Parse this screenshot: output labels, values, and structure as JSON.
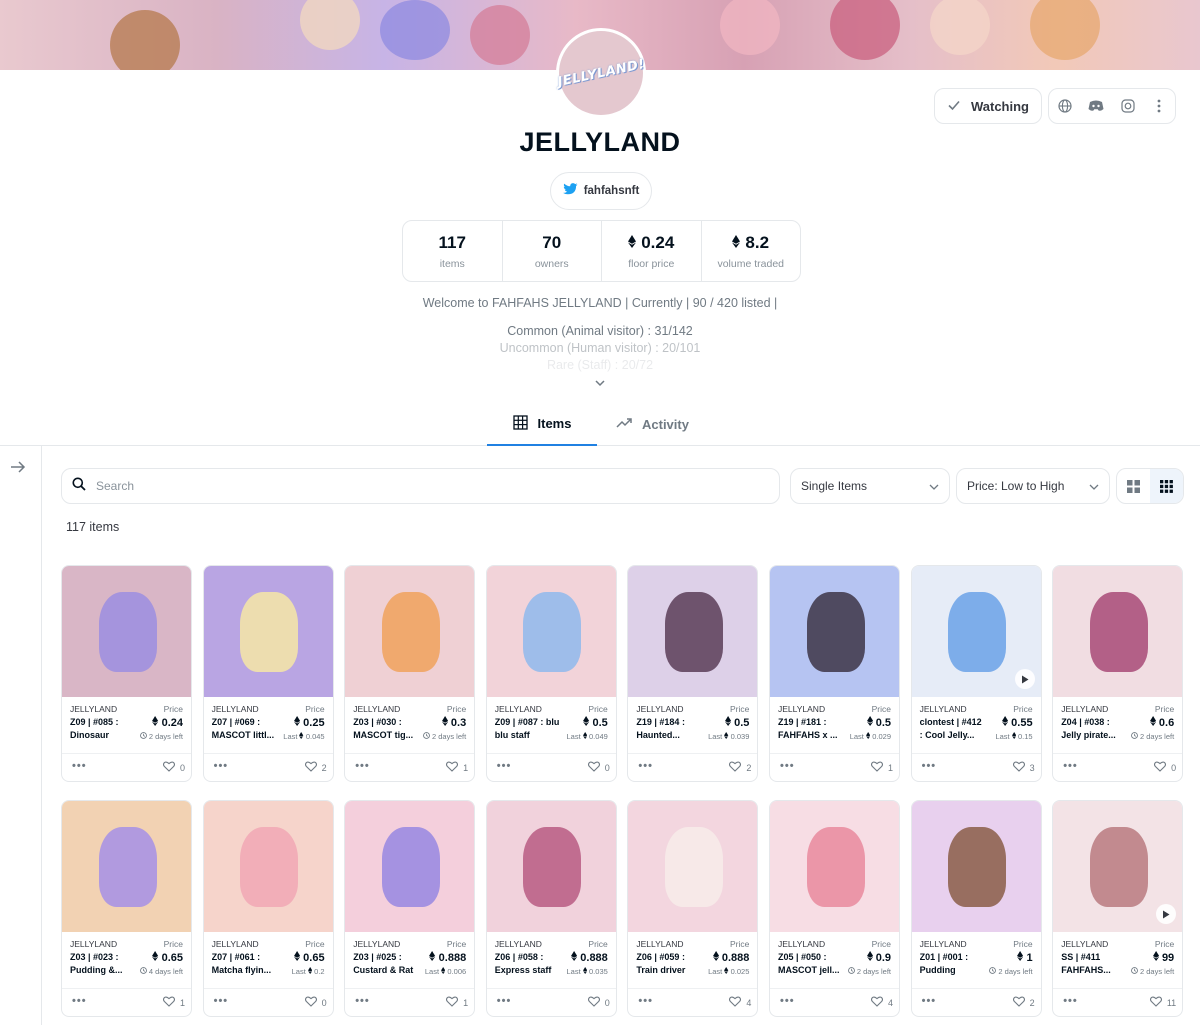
{
  "collection": {
    "name": "JELLYLAND",
    "logo_text": "JELLYLAND!",
    "twitter_handle": "fahfahsnft"
  },
  "actions": {
    "watch_label": "Watching",
    "icons": [
      "globe-icon",
      "discord-icon",
      "instagram-icon",
      "more-vertical-icon"
    ]
  },
  "stats": [
    {
      "value": "117",
      "label": "items",
      "eth": false
    },
    {
      "value": "70",
      "label": "owners",
      "eth": false
    },
    {
      "value": "0.24",
      "label": "floor price",
      "eth": true
    },
    {
      "value": "8.2",
      "label": "volume traded",
      "eth": true
    }
  ],
  "description": {
    "line1": "Welcome to FAHFAHS JELLYLAND | Currently | 90 / 420 listed |",
    "line2": "Common (Animal visitor) : 31/142",
    "line3": "Uncommon (Human visitor) : 20/101",
    "line4": "Rare (Staff) : 20/72"
  },
  "tabs": [
    {
      "label": "Items",
      "active": true
    },
    {
      "label": "Activity",
      "active": false
    }
  ],
  "filters": {
    "search_placeholder": "Search",
    "item_type": "Single Items",
    "sort": "Price: Low to High",
    "item_count": "117 items"
  },
  "colors": {
    "accent": "#2081e2",
    "border": "#e5e8eb",
    "text": "#04111d"
  },
  "cards": [
    {
      "collection": "JELLYLAND",
      "price_label": "Price",
      "name": "Z09 | #085 : Dinosaur",
      "price": "0.24",
      "sub_type": "time",
      "sub": "2 days left",
      "likes": "0",
      "bg": "#d9b6c6",
      "fig": "#9b8ee0",
      "video": false
    },
    {
      "collection": "JELLYLAND",
      "price_label": "Price",
      "name": "Z07 | #069 : MASCOT littl...",
      "price": "0.25",
      "sub_type": "last",
      "sub": "0.045",
      "likes": "2",
      "bg": "#b9a5e3",
      "fig": "#f6e6a6",
      "video": false
    },
    {
      "collection": "JELLYLAND",
      "price_label": "Price",
      "name": "Z03 | #030 : MASCOT tig...",
      "price": "0.3",
      "sub_type": "time",
      "sub": "2 days left",
      "likes": "1",
      "bg": "#efd0d4",
      "fig": "#f0a25c",
      "video": false
    },
    {
      "collection": "JELLYLAND",
      "price_label": "Price",
      "name": "Z09 | #087 : blu blu staff",
      "price": "0.5",
      "sub_type": "last",
      "sub": "0.049",
      "likes": "0",
      "bg": "#f2d3d9",
      "fig": "#8fb8ec",
      "video": false
    },
    {
      "collection": "JELLYLAND",
      "price_label": "Price",
      "name": "Z19 | #184 : Haunted...",
      "price": "0.5",
      "sub_type": "last",
      "sub": "0.039",
      "likes": "2",
      "bg": "#ddd0e8",
      "fig": "#5b3d57",
      "video": false
    },
    {
      "collection": "JELLYLAND",
      "price_label": "Price",
      "name": "Z19 | #181 : FAHFAHS x ...",
      "price": "0.5",
      "sub_type": "last",
      "sub": "0.029",
      "likes": "1",
      "bg": "#b6c4f2",
      "fig": "#3d3546",
      "video": false
    },
    {
      "collection": "JELLYLAND",
      "price_label": "Price",
      "name": "clontest | #412 : Cool Jelly...",
      "price": "0.55",
      "sub_type": "last",
      "sub": "0.15",
      "likes": "3",
      "bg": "#e6ecf7",
      "fig": "#6aa2e8",
      "video": true
    },
    {
      "collection": "JELLYLAND",
      "price_label": "Price",
      "name": "Z04 | #038 : Jelly pirate...",
      "price": "0.6",
      "sub_type": "time",
      "sub": "2 days left",
      "likes": "0",
      "bg": "#f1dde2",
      "fig": "#a84a77",
      "video": false
    },
    {
      "collection": "JELLYLAND",
      "price_label": "Price",
      "name": "Z03 | #023 : Pudding &...",
      "price": "0.65",
      "sub_type": "time",
      "sub": "4 days left",
      "likes": "1",
      "bg": "#f2d2b3",
      "fig": "#a690e6",
      "video": false
    },
    {
      "collection": "JELLYLAND",
      "price_label": "Price",
      "name": "Z07 | #061 : Matcha flyin...",
      "price": "0.65",
      "sub_type": "last",
      "sub": "0.2",
      "likes": "0",
      "bg": "#f6d4cb",
      "fig": "#f1a7b5",
      "video": false
    },
    {
      "collection": "JELLYLAND",
      "price_label": "Price",
      "name": "Z03 | #025 : Custard & Rat",
      "price": "0.888",
      "sub_type": "last",
      "sub": "0.006",
      "likes": "1",
      "bg": "#f4cfdc",
      "fig": "#9687e2",
      "video": false
    },
    {
      "collection": "JELLYLAND",
      "price_label": "Price",
      "name": "Z06 | #058 : Express staff",
      "price": "0.888",
      "sub_type": "last",
      "sub": "0.035",
      "likes": "0",
      "bg": "#f1d2dc",
      "fig": "#b85c82",
      "video": false
    },
    {
      "collection": "JELLYLAND",
      "price_label": "Price",
      "name": "Z06 | #059 : Train driver",
      "price": "0.888",
      "sub_type": "last",
      "sub": "0.025",
      "likes": "4",
      "bg": "#f3d6df",
      "fig": "#f7ecea",
      "video": false
    },
    {
      "collection": "JELLYLAND",
      "price_label": "Price",
      "name": "Z05 | #050 : MASCOT jell...",
      "price": "0.9",
      "sub_type": "time",
      "sub": "2 days left",
      "likes": "4",
      "bg": "#f7dde4",
      "fig": "#e98a9e",
      "video": false
    },
    {
      "collection": "JELLYLAND",
      "price_label": "Price",
      "name": "Z01 | #001 : Pudding",
      "price": "1",
      "sub_type": "time",
      "sub": "2 days left",
      "likes": "2",
      "bg": "#e8d0ee",
      "fig": "#8a5d47",
      "video": false
    },
    {
      "collection": "JELLYLAND",
      "price_label": "Price",
      "name": "SS | #411 FAHFAHS...",
      "price": "99",
      "sub_type": "time",
      "sub": "2 days left",
      "likes": "11",
      "bg": "#f3e3e6",
      "fig": "#b87a7f",
      "video": true
    }
  ]
}
